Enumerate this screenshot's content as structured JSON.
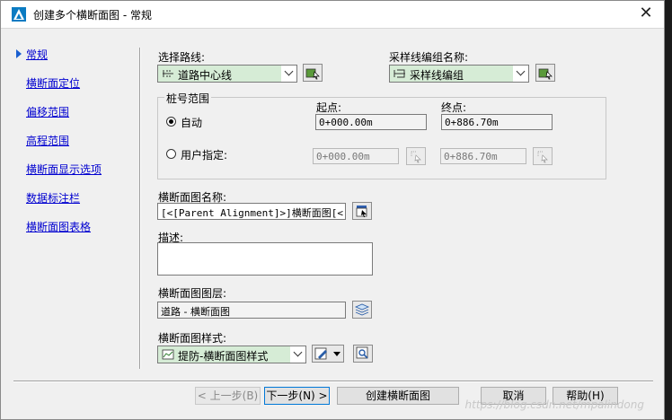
{
  "window": {
    "title": "创建多个横断面图 - 常规",
    "close_glyph": "✕"
  },
  "nav": {
    "items": [
      "常规",
      "横断面定位",
      "偏移范围",
      "高程范围",
      "横断面显示选项",
      "数据标注栏",
      "横断面图表格"
    ]
  },
  "alignment": {
    "label": "选择路线:",
    "value": "道路中心线"
  },
  "sample_group": {
    "label": "采样线编组名称:",
    "value": "采样线编组"
  },
  "station_range": {
    "group_title": "桩号范围",
    "start_label": "起点:",
    "end_label": "终点:",
    "auto_label": "自动",
    "auto_start": "0+000.00m",
    "auto_end": "0+886.70m",
    "user_label": "用户指定:",
    "user_start": "0+000.00m",
    "user_end": "0+886.70m"
  },
  "view_name": {
    "label": "横断面图名称:",
    "value": "[<[Parent Alignment]>]横断面图[<[S"
  },
  "description": {
    "label": "描述:",
    "value": ""
  },
  "layer": {
    "label": "横断面图图层:",
    "value": "道路 - 横断面图"
  },
  "style": {
    "label": "横断面图样式:",
    "value": "提防-横断面图样式"
  },
  "buttons": {
    "back": "< 上一步(B)",
    "next": "下一步(N) >",
    "create": "创建横断面图",
    "cancel": "取消",
    "help": "帮助(H)"
  },
  "watermark": "https://blog.csdn.net/mpalindong",
  "colors": {
    "accent": "#0078d7",
    "link": "#0000d0",
    "combo_bg": "#d6ecd6"
  }
}
